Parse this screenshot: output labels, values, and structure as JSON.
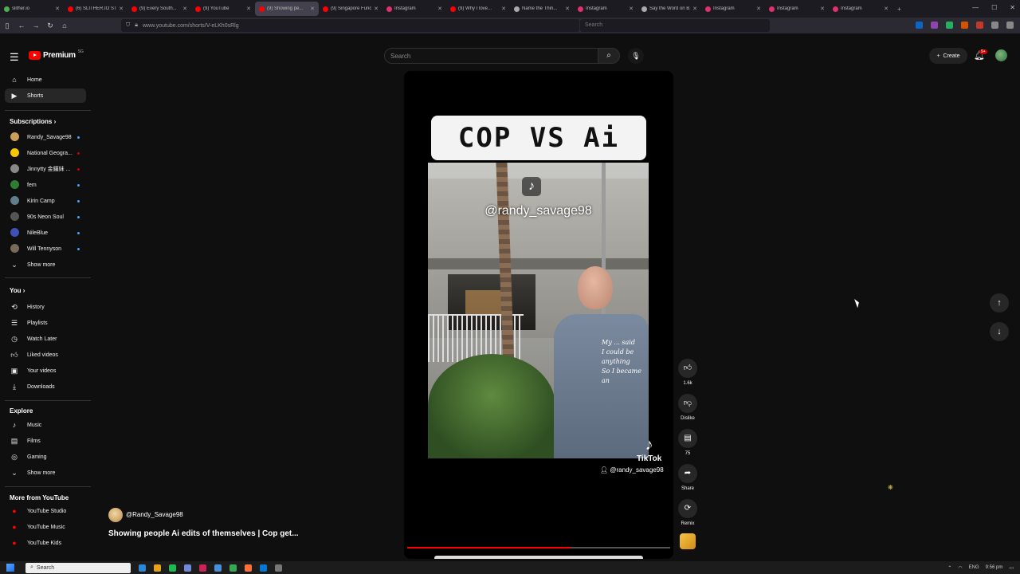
{
  "browser": {
    "tabs": [
      {
        "label": "slither.io",
        "color": "#4caf50"
      },
      {
        "label": "(6) SLITHER.IO STR...",
        "color": "#ff0000"
      },
      {
        "label": "(9) Every South...",
        "color": "#ff0000"
      },
      {
        "label": "(9) YouTube",
        "color": "#ff0000"
      },
      {
        "label": "(9) Showing pe...",
        "color": "#ff0000",
        "active": true
      },
      {
        "label": "(9) Singapore Func...",
        "color": "#ff0000"
      },
      {
        "label": "Instagram",
        "color": "#e1306c"
      },
      {
        "label": "(9) Why I love...",
        "color": "#ff0000"
      },
      {
        "label": "Name the Thin...",
        "color": "#aaaaaa"
      },
      {
        "label": "Instagram",
        "color": "#e1306c"
      },
      {
        "label": "Say the Word on B...",
        "color": "#aaaaaa"
      },
      {
        "label": "Instagram",
        "color": "#e1306c"
      },
      {
        "label": "Instagram",
        "color": "#e1306c"
      },
      {
        "label": "Instagram",
        "color": "#e1306c"
      }
    ],
    "url": "www.youtube.com/shorts/V-eLKh0sRlg",
    "search_placeholder": "Search"
  },
  "header": {
    "brand": "Premium",
    "brand_sup": "SG",
    "search_placeholder": "Search",
    "create_label": "Create",
    "notif_badge": "9+"
  },
  "sidebar": {
    "home": "Home",
    "shorts": "Shorts",
    "subscriptions_title": "Subscriptions",
    "subscriptions": [
      {
        "name": "Randy_Savage98",
        "color": "#c9a05a"
      },
      {
        "name": "National Geogra...",
        "color": "#f6c600",
        "live": true
      },
      {
        "name": "Jinnytty 金鑼妹 ...",
        "color": "#888888",
        "live": true
      },
      {
        "name": "fem",
        "color": "#2e7d32"
      },
      {
        "name": "Kirin Camp",
        "color": "#607d8b"
      },
      {
        "name": "90s Neon Soul",
        "color": "#555555"
      },
      {
        "name": "NileBlue",
        "color": "#3f51b5"
      },
      {
        "name": "Will Tennyson",
        "color": "#7a6a5a"
      }
    ],
    "show_more": "Show more",
    "you_title": "You",
    "you_items": [
      "History",
      "Playlists",
      "Watch Later",
      "Liked videos",
      "Your videos",
      "Downloads"
    ],
    "explore_title": "Explore",
    "explore_items": [
      "Music",
      "Films",
      "Gaming"
    ],
    "explore_show_more": "Show more",
    "more_title": "More from YouTube",
    "more_items": [
      "YouTube Studio",
      "YouTube Music",
      "YouTube Kids"
    ]
  },
  "video": {
    "caption": "COP VS Ai",
    "watermark_handle": "@randy_savage98",
    "tiktok_label": "TikTok",
    "tiktok_handle": "@randy_savage98",
    "shirt_text": "My ... said\nI could be anything\nSo I became an",
    "progress_fraction": 0.62
  },
  "actions": {
    "likes": "1.6k",
    "dislike": "Dislike",
    "comments": "75",
    "share": "Share",
    "remix": "Remix"
  },
  "meta": {
    "channel": "@Randy_Savage98",
    "title": "Showing people Ai edits of themselves | Cop get..."
  },
  "taskbar": {
    "search": "Search",
    "lang": "ENG",
    "time": "9:56 pm"
  },
  "colors": {
    "yt_red": "#ff0000",
    "bg": "#0f0f0f"
  }
}
